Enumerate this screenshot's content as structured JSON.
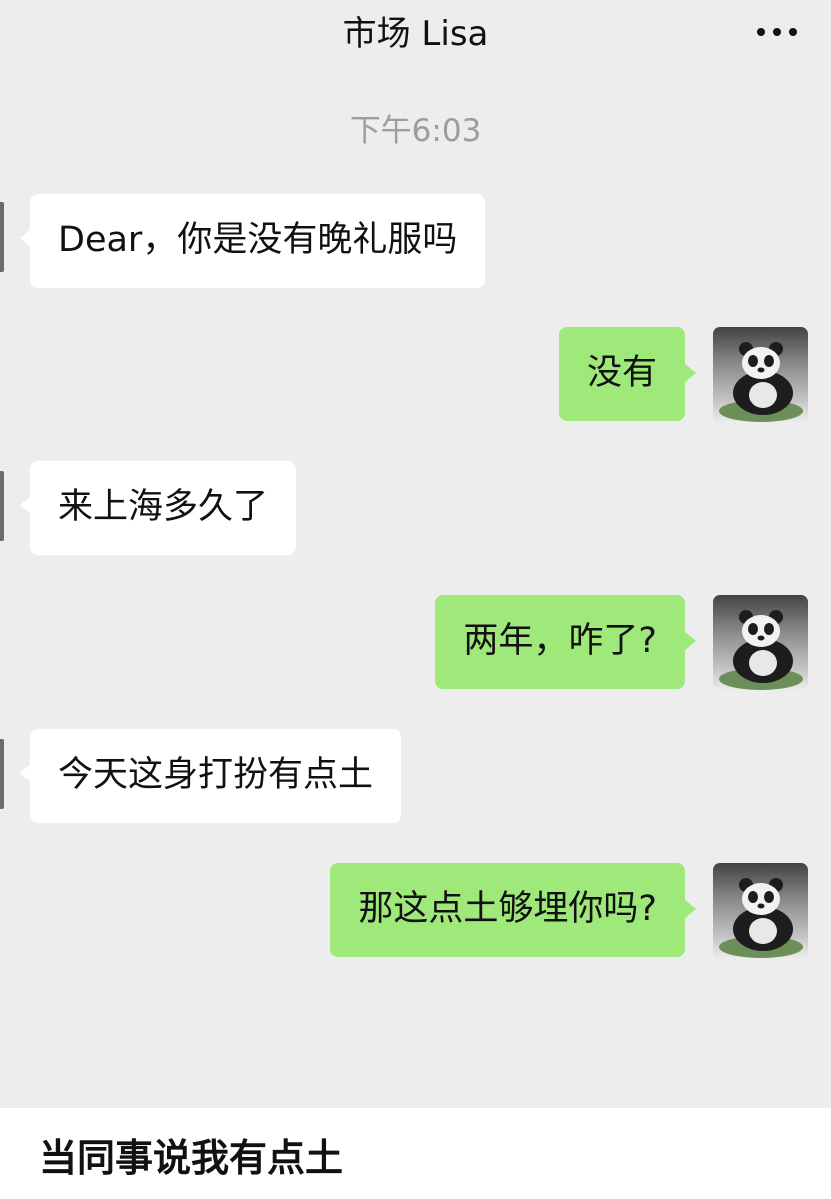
{
  "header": {
    "title": "市场 Lisa",
    "more_icon": "more-dots-icon"
  },
  "timestamp": "下午6:03",
  "messages": [
    {
      "sender": "other",
      "text": "Dear，你是没有晚礼服吗"
    },
    {
      "sender": "me",
      "text": "没有"
    },
    {
      "sender": "other",
      "text": "来上海多久了"
    },
    {
      "sender": "me",
      "text": "两年，咋了?"
    },
    {
      "sender": "other",
      "text": "今天这身打扮有点土"
    },
    {
      "sender": "me",
      "text": "那这点土够埋你吗?"
    }
  ],
  "avatar": {
    "icon": "panda-avatar-icon"
  },
  "caption": "当同事说我有点土",
  "colors": {
    "background": "#ededed",
    "incoming_bubble": "#ffffff",
    "outgoing_bubble": "#9fe97a",
    "timestamp": "#9d9d9d"
  }
}
